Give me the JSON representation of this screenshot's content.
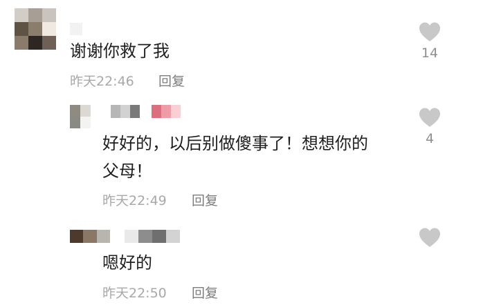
{
  "comments": [
    {
      "text_line1": "谢谢你救了我",
      "time": "昨天22:46",
      "reply_label": "回复",
      "like_count": "14"
    },
    {
      "text_line1": "好好的，以后别做傻事了！想想你的",
      "text_line2": "父母！",
      "time": "昨天22:49",
      "reply_label": "回复",
      "like_count": "4"
    },
    {
      "text_line1": "嗯好的",
      "time": "昨天22:50",
      "reply_label": "回复",
      "like_count": ""
    }
  ],
  "icons": {
    "like": "heart-icon"
  },
  "colors": {
    "text": "#1e1e1e",
    "meta": "#a8a8a8",
    "reply": "#7c7c7c",
    "heart": "#c8c8c8"
  }
}
